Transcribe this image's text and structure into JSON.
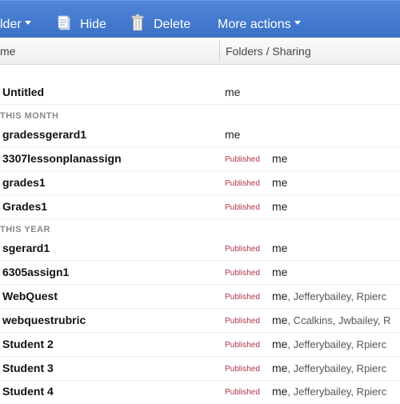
{
  "toolbar": {
    "folder_label": "lder",
    "hide_label": "Hide",
    "delete_label": "Delete",
    "more_actions_label": "More actions",
    "icons": [
      "hide-icon",
      "delete-icon"
    ]
  },
  "columns": {
    "name": "me",
    "folders_sharing": "Folders / Sharing"
  },
  "groups": {
    "this_month": "THIS MONTH",
    "this_year": "THIS YEAR"
  },
  "rows": [
    {
      "name": "Untitled",
      "status": "",
      "owner": "me",
      "others": ""
    },
    {
      "name": "gradessgerard1",
      "status": "",
      "owner": "me",
      "others": ""
    },
    {
      "name": "3307lessonplanassign",
      "status": "Published",
      "owner": "me",
      "others": ""
    },
    {
      "name": "grades1",
      "status": "Published",
      "owner": "me",
      "others": ""
    },
    {
      "name": "Grades1",
      "status": "Published",
      "owner": "me",
      "others": ""
    },
    {
      "name": "sgerard1",
      "status": "Published",
      "owner": "me",
      "others": ""
    },
    {
      "name": "6305assign1",
      "status": "Published",
      "owner": "me",
      "others": ""
    },
    {
      "name": "WebQuest",
      "status": "Published",
      "owner": "me",
      "others": ", Jefferybailey, Rpierc"
    },
    {
      "name": "webquestrubric",
      "status": "Published",
      "owner": "me",
      "others": ", Ccalkins, Jwbailey, R"
    },
    {
      "name": "Student 2",
      "status": "Published",
      "owner": "me",
      "others": ", Jefferybailey, Rpierc"
    },
    {
      "name": "Student 3",
      "status": "Published",
      "owner": "me",
      "others": ", Jefferybailey, Rpierc"
    },
    {
      "name": "Student 4",
      "status": "Published",
      "owner": "me",
      "others": ", Jefferybailey, Rpierc"
    }
  ],
  "colors": {
    "toolbar": "#3f77cc",
    "published": "#b0324a"
  }
}
